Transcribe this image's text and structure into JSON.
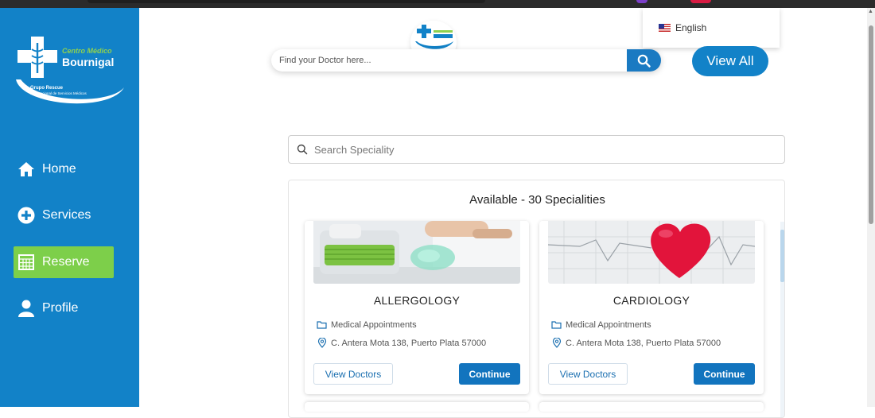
{
  "sidebar": {
    "logo": {
      "line1": "Centro Médico",
      "line2": "Bournigal",
      "sub1": "Grupo Rescue",
      "sub2": "Red Nacional de Servicios Médicos"
    },
    "items": [
      {
        "label": "Home",
        "icon": "home-icon"
      },
      {
        "label": "Services",
        "icon": "plus-circle-icon"
      },
      {
        "label": "Reserve",
        "icon": "calendar-grid-icon"
      },
      {
        "label": "Profile",
        "icon": "user-icon"
      }
    ],
    "active_item": "Reserve",
    "colors": {
      "background": "#1282c8",
      "active": "#7dcf4a"
    }
  },
  "header": {
    "language": "English",
    "doctor_search_placeholder": "Find your Doctor here...",
    "view_all_label": "View All"
  },
  "specialities": {
    "search_placeholder": "Search Speciality",
    "title": "Available - 30 Specialities",
    "cards": [
      {
        "name": "ALLERGOLOGY",
        "category": "Medical Appointments",
        "address": "C. Antera Mota 138, Puerto Plata 57000",
        "view_label": "View Doctors",
        "continue_label": "Continue"
      },
      {
        "name": "CARDIOLOGY",
        "category": "Medical Appointments",
        "address": "C. Antera Mota 138, Puerto Plata 57000",
        "view_label": "View Doctors",
        "continue_label": "Continue"
      }
    ]
  },
  "colors": {
    "primary": "#1274be",
    "accent_green": "#7dcf4a"
  }
}
